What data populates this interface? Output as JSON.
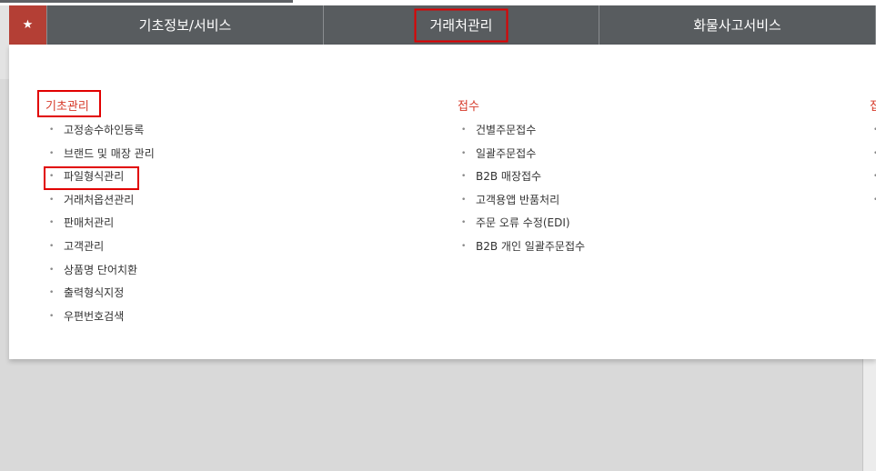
{
  "nav": {
    "star": "★",
    "tabs": [
      "기초정보/서비스",
      "거래처관리",
      "화물사고서비스"
    ]
  },
  "menu": {
    "columns": [
      {
        "title": "기초관리",
        "items": [
          "고정송수하인등록",
          "브랜드 및 매장 관리",
          "파일형식관리",
          "거래처옵션관리",
          "판매처관리",
          "고객관리",
          "상품명 단어치환",
          "출력형식지정",
          "우편번호검색"
        ]
      },
      {
        "title": "접수",
        "items": [
          "건별주문접수",
          "일괄주문접수",
          "B2B 매장접수",
          "고객용앱 반품처리",
          "주문 오류 수정(EDI)",
          "B2B 개인 일괄주문접수"
        ]
      },
      {
        "title": "접",
        "items": [
          "",
          "",
          "",
          ""
        ]
      }
    ]
  },
  "colors": {
    "accent": "#d63b2b",
    "nav": "#585c5f",
    "highlight": "#e10000"
  }
}
